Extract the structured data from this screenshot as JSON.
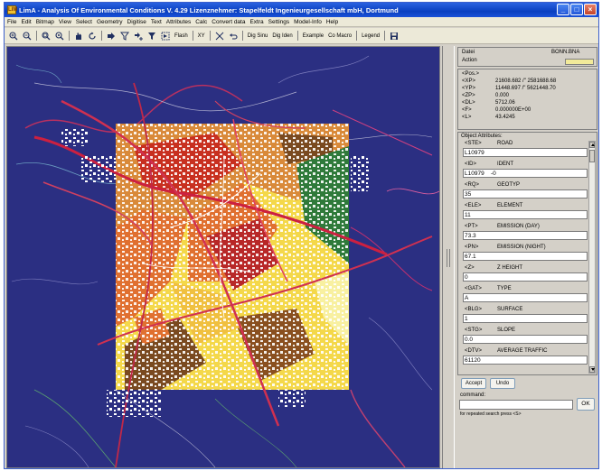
{
  "window": {
    "title": "LimA - Analysis Of Environmental Conditions    V. 4.29    Lizenznehmer: Stapelfeldt Ingenieurgesellschaft mbH, Dortmund",
    "app_icon_label": "LIM",
    "btn_minimize": "_",
    "btn_maximize": "□",
    "btn_close": "×"
  },
  "menu": [
    "File",
    "Edit",
    "Bitmap",
    "View",
    "Select",
    "Geometry",
    "Digitise",
    "Text",
    "Attributes",
    "Calc",
    "Convert data",
    "Extra",
    "Settings",
    "Model-Info",
    "Help"
  ],
  "toolbar": {
    "text_buttons": {
      "flash": "Flash",
      "xy": "XY",
      "dig_sinu": "Dig Sinu",
      "dig_iden": "Dig Iden",
      "example": "Example",
      "co_macro": "Co Macro",
      "legend": "Legend"
    },
    "icons": [
      "zoom-in-icon",
      "zoom-out-icon",
      "zoom-window-icon",
      "zoom-extent-icon",
      "pan-icon",
      "redraw-icon",
      "select-icon",
      "filter-icon",
      "select-plus-icon",
      "select-area-icon",
      "select-all-icon",
      "crosshair-icon",
      "undo-icon",
      "save-icon"
    ]
  },
  "info": {
    "file_label": "Datei",
    "file_value": "BONN.BNA",
    "action_label": "Action"
  },
  "position": {
    "header": "<Pos.>",
    "rows": [
      {
        "key": "<XP>",
        "value": "21608.682 /\" 2581688.68"
      },
      {
        "key": "<YP>",
        "value": "11448.697 /\" 5621448.70"
      },
      {
        "key": "<ZP>",
        "value": "0.000"
      },
      {
        "key": "<DL>",
        "value": "5712.06"
      },
      {
        "key": "<F>",
        "value": "0.000000E+00"
      },
      {
        "key": "<L>",
        "value": "43.4245"
      }
    ]
  },
  "attributes": {
    "title": "Object Attributes:",
    "fields": [
      {
        "tag": "<STE>",
        "name": "ROAD",
        "value": "L10979"
      },
      {
        "tag": "<ID>",
        "name": "IDENT",
        "value": "L10979    -0"
      },
      {
        "tag": "<RQ>",
        "name": "GEOTYP",
        "value": "35"
      },
      {
        "tag": "<ELE>",
        "name": "ELEMENT",
        "value": "11"
      },
      {
        "tag": "<PT>",
        "name": "EMISSION (DAY)",
        "value": "73.3"
      },
      {
        "tag": "<PN>",
        "name": "EMISSION (NIGHT)",
        "value": "67.1"
      },
      {
        "tag": "<Z>",
        "name": "Z HEIGHT",
        "value": "0"
      },
      {
        "tag": "<GAT>",
        "name": "TYPE",
        "value": "A"
      },
      {
        "tag": "<BLG>",
        "name": "SURFACE",
        "value": "1"
      },
      {
        "tag": "<STG>",
        "name": "SLOPE",
        "value": "0.0"
      },
      {
        "tag": "<DTV>",
        "name": "AVERAGE TRAFFIC",
        "value": "61120"
      }
    ]
  },
  "buttons": {
    "accept": "Accept",
    "undo": "Undo",
    "ok": "OK"
  },
  "command": {
    "label": "command:",
    "value": "",
    "hint": "for repeated search press  <S>"
  },
  "colors": {
    "map_background": "#2b2f82",
    "title_bar": "#0a3fc0",
    "panel": "#d4d0c8",
    "action_indicator": "#f2ea9a"
  }
}
